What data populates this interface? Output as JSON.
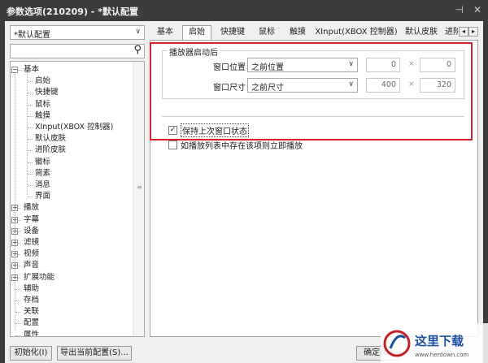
{
  "window": {
    "title": "参数选项(210209) - *默认配置",
    "pin_glyph": "⊣",
    "close_glyph": "✕"
  },
  "sidebar": {
    "profile_value": "*默认配置",
    "search_value": "",
    "tree": [
      {
        "label": "基本",
        "exp": "−"
      },
      {
        "label": "启始"
      },
      {
        "label": "快捷键"
      },
      {
        "label": "鼠标"
      },
      {
        "label": "触摸"
      },
      {
        "label": "XInput(XBOX 控制器)"
      },
      {
        "label": "默认皮肤"
      },
      {
        "label": "进阶皮肤"
      },
      {
        "label": "徽标"
      },
      {
        "label": "简素"
      },
      {
        "label": "消息"
      },
      {
        "label": "界面"
      },
      {
        "label": "播放",
        "exp": "+"
      },
      {
        "label": "字幕",
        "exp": "+"
      },
      {
        "label": "设备",
        "exp": "+"
      },
      {
        "label": "滤镜",
        "exp": "+"
      },
      {
        "label": "视频",
        "exp": "+"
      },
      {
        "label": "声音",
        "exp": "+"
      },
      {
        "label": "扩展功能",
        "exp": "+"
      },
      {
        "label": "辅助"
      },
      {
        "label": "存档"
      },
      {
        "label": "关联"
      },
      {
        "label": "配置"
      },
      {
        "label": "属性"
      }
    ]
  },
  "tabs": [
    "基本",
    "启始",
    "快捷键",
    "鼠标",
    "触摸",
    "XInput(XBOX 控制器)",
    "默认皮肤",
    "进阶"
  ],
  "active_tab": "启始",
  "tab_scroll": {
    "left": "◂",
    "right": "▸"
  },
  "startup": {
    "group_title": "播放器启动后",
    "window_position": {
      "label": "窗口位置：",
      "value": "之前位置",
      "x": "0",
      "y": "0"
    },
    "window_size": {
      "label": "窗口尺寸：",
      "value": "之前尺寸",
      "w": "400",
      "h": "320"
    },
    "times_sign": "×",
    "keep_state": {
      "label": "保持上次窗口状态",
      "checked": true
    },
    "play_if_list": {
      "label": "如播放列表中存在该项则立即播放",
      "checked": false
    }
  },
  "footer": {
    "init_button": "初始化(I)",
    "export_button": "导出当前配置(S)...",
    "ok_button": "确定(O)"
  },
  "colors": {
    "highlight_border": "#d6202a",
    "titlebar": "#3c3c3c"
  }
}
